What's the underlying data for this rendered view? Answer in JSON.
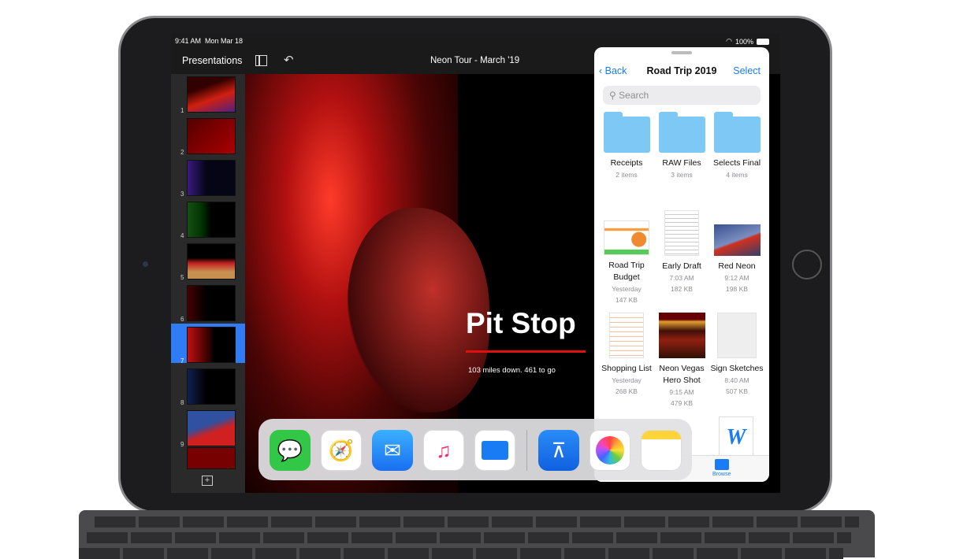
{
  "status": {
    "time": "9:41 AM",
    "date": "Mon Mar 18",
    "battery": "100%"
  },
  "toolbar": {
    "presentations": "Presentations",
    "title": "Neon Tour - March '19"
  },
  "navigator": {
    "slides": [
      "1",
      "2",
      "3",
      "4",
      "5",
      "6",
      "7",
      "8",
      "9"
    ],
    "selected": "7"
  },
  "slide": {
    "title": "Pit Stop",
    "subtitle": "103 miles down. 461 to go"
  },
  "files": {
    "back": "Back",
    "title": "Road Trip 2019",
    "select": "Select",
    "search_placeholder": "Search",
    "items": [
      {
        "name": "Receipts",
        "meta1": "2 items",
        "type": "folder"
      },
      {
        "name": "RAW Files",
        "meta1": "3 items",
        "type": "folder"
      },
      {
        "name": "Selects Final",
        "meta1": "4 items",
        "type": "folder"
      },
      {
        "name": "Road Trip Budget",
        "meta1": "Yesterday",
        "meta2": "147 KB",
        "type": "spreadsheet"
      },
      {
        "name": "Early Draft",
        "meta1": "7:03 AM",
        "meta2": "182 KB",
        "type": "document"
      },
      {
        "name": "Red Neon",
        "meta1": "9:12 AM",
        "meta2": "198 KB",
        "type": "image"
      },
      {
        "name": "Shopping List",
        "meta1": "Yesterday",
        "meta2": "268 KB",
        "type": "document"
      },
      {
        "name": "Neon Vegas Hero Shot",
        "meta1": "9:15 AM",
        "meta2": "479 KB",
        "type": "image"
      },
      {
        "name": "Sign Sketches",
        "meta1": "8:40 AM",
        "meta2": "507 KB",
        "type": "image"
      }
    ],
    "tab_browse": "Browse"
  },
  "dock": [
    "messages",
    "safari",
    "mail",
    "music",
    "files",
    "keynote",
    "photos",
    "notes"
  ],
  "colors": {
    "accent": "#1a7cf5",
    "selection": "#2f7cf6",
    "slide_line": "#e01010"
  }
}
